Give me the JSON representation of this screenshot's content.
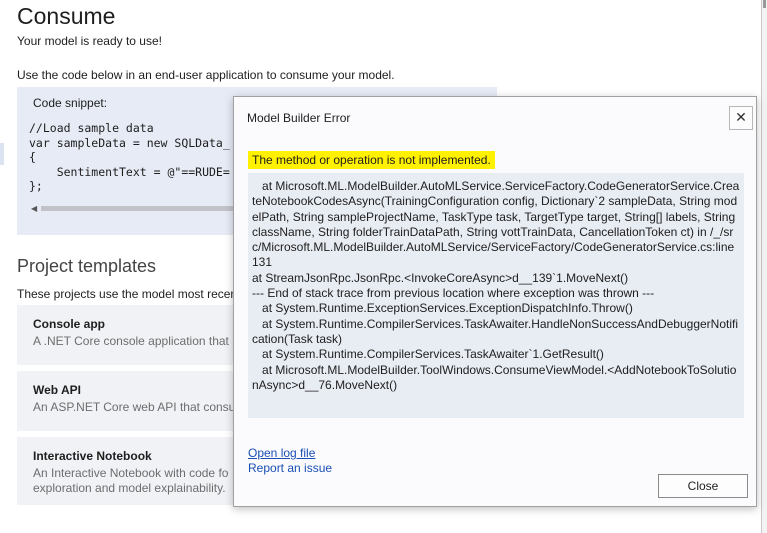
{
  "consume": {
    "title": "Consume",
    "subtitle": "Your model is ready to use!",
    "instruction": "Use the code below in an end-user application to consume your model.",
    "snippet_label": "Code snippet:",
    "code_lines": [
      "//Load sample data",
      "var sampleData = new SQLData_",
      "{",
      "    SentimentText = @\"==RUDE=",
      "};"
    ]
  },
  "project_templates": {
    "title": "Project templates",
    "description": "These projects use the model most recen",
    "cards": [
      {
        "title": "Console app",
        "description": "A .NET Core console application that u"
      },
      {
        "title": "Web API",
        "description": "An ASP.NET Core web API that consur"
      },
      {
        "title": "Interactive Notebook",
        "description": "An Interactive Notebook with code fo\nexploration and model explainability."
      }
    ]
  },
  "dialog": {
    "title": "Model Builder Error",
    "close_icon": "close-icon",
    "error_message": "The method or operation is not implemented.",
    "stack_trace": "   at Microsoft.ML.ModelBuilder.AutoMLService.ServiceFactory.CodeGeneratorService.CreateNotebookCodesAsync(TrainingConfiguration config, Dictionary`2 sampleData, String modelPath, String sampleProjectName, TaskType task, TargetType target, String[] labels, String className, String folderTrainDataPath, String vottTrainData, CancellationToken ct) in /_/src/Microsoft.ML.ModelBuilder.AutoMLService/ServiceFactory/CodeGeneratorService.cs:line 131\nat StreamJsonRpc.JsonRpc.<InvokeCoreAsync>d__139`1.MoveNext()\n--- End of stack trace from previous location where exception was thrown ---\n   at System.Runtime.ExceptionServices.ExceptionDispatchInfo.Throw()\n   at System.Runtime.CompilerServices.TaskAwaiter.HandleNonSuccessAndDebuggerNotification(Task task)\n   at System.Runtime.CompilerServices.TaskAwaiter`1.GetResult()\n   at Microsoft.ML.ModelBuilder.ToolWindows.ConsumeViewModel.<AddNotebookToSolutionAsync>d__76.MoveNext()",
    "open_log_link": "Open log file",
    "report_link": "Report an issue",
    "close_button": "Close"
  },
  "colors": {
    "highlight": "#fff100",
    "link": "#1a4fb4",
    "panel": "#e6ebf5"
  }
}
